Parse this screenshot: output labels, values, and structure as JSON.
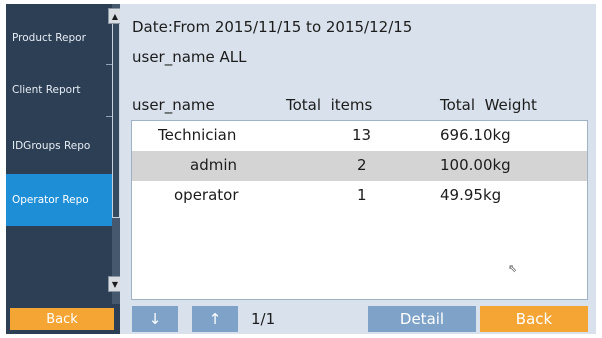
{
  "sidebar": {
    "items": [
      {
        "label": "Product Repor",
        "active": false
      },
      {
        "label": "Client Report",
        "active": false
      },
      {
        "label": "IDGroups Repo",
        "active": false
      },
      {
        "label": "Operator Repo",
        "active": true
      }
    ],
    "back_label": "Back",
    "scroll_up_icon": "triangle-up-icon",
    "scroll_down_icon": "triangle-down-icon"
  },
  "header": {
    "date_range": "Date:From 2015/11/15 to 2015/12/15",
    "user_filter": "user_name ALL"
  },
  "table": {
    "columns": [
      "user_name",
      "Total  items",
      "Total  Weight"
    ],
    "rows": [
      {
        "user_name": "Technician",
        "total_items": "13",
        "total_weight": "696.10kg"
      },
      {
        "user_name": "admin",
        "total_items": "2",
        "total_weight": "100.00kg"
      },
      {
        "user_name": "operator",
        "total_items": "1",
        "total_weight": "49.95kg"
      }
    ]
  },
  "bottom": {
    "down_arrow": "↓",
    "up_arrow": "↑",
    "page_indicator": "1/1",
    "detail_label": "Detail",
    "back_label": "Back"
  },
  "colors": {
    "sidebar_bg": "#2c3f55",
    "active_item": "#1e8fd6",
    "main_bg": "#d9e2ec",
    "button_blue": "#7fa3c8",
    "button_orange": "#f4a534",
    "row_shade": "#d4d4d4"
  }
}
